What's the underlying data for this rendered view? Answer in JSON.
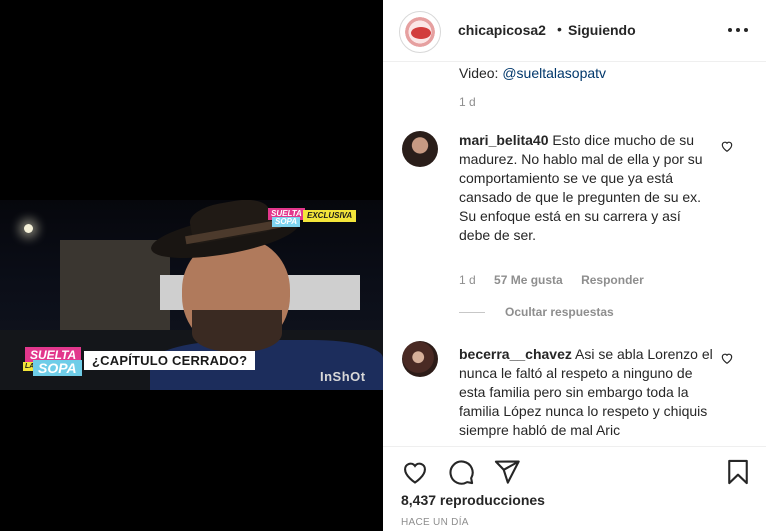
{
  "video": {
    "badge_suelta_top": "SUELTA",
    "badge_sopa_top": "SOPA",
    "badge_exclusiva": "EXCLUSIVA",
    "badge_suelta": "SUELTA",
    "badge_la": "LA",
    "badge_sopa": "SOPA",
    "headline": "¿CAPÍTULO CERRADO?",
    "watermark": "InShOt"
  },
  "header": {
    "username": "chicapicosa2",
    "separator": "•",
    "follow_status": "Siguiendo",
    "more_icon": "more-horizontal-icon"
  },
  "caption": {
    "prefix": "Video: ",
    "mention": "@sueltalasopatv",
    "time": "1 d"
  },
  "comments": [
    {
      "username": "mari_belita40",
      "text": "Esto dice mucho de su madurez. No hablo mal de ella y por su comportamiento se ve que ya está cansado de que le pregunten de su ex. Su enfoque está en su carrera y así debe de ser.",
      "time": "1 d",
      "likes": "57 Me gusta",
      "reply_label": "Responder",
      "replies_toggle": "Ocultar respuestas"
    },
    {
      "username": "becerra__chavez",
      "text": "Asi se abla Lorenzo el nunca le faltó al respeto a ninguno de esta familia pero sin embargo toda la familia López nunca lo respeto y chiquis siempre habló de mal Aric"
    }
  ],
  "actions": {
    "views_number": "8,437",
    "views_label": " reproducciones",
    "posted": "HACE UN DÍA",
    "icons": [
      "heart-icon",
      "comment-icon",
      "share-icon",
      "bookmark-icon"
    ]
  }
}
